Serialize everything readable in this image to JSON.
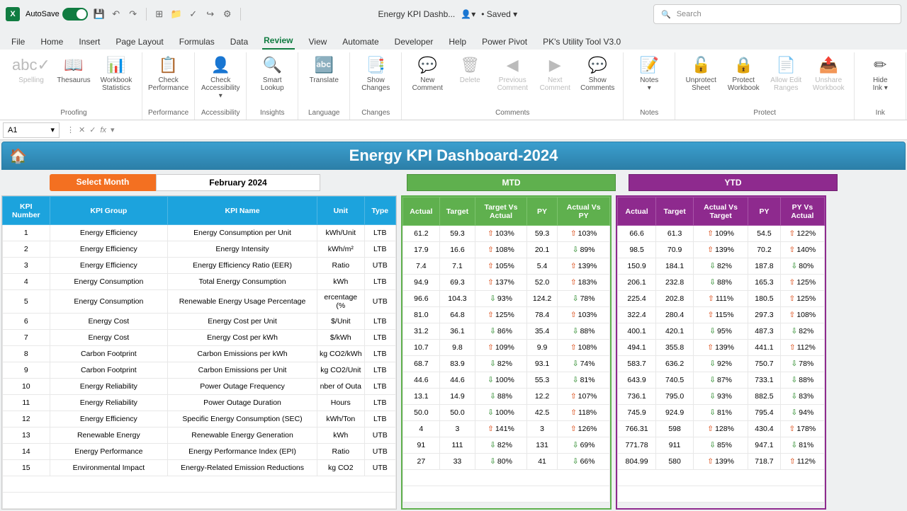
{
  "titlebar": {
    "autosave": "AutoSave",
    "docname": "Energy KPI Dashb...",
    "saved": "Saved",
    "search_ph": "Search"
  },
  "tabs": [
    "File",
    "Home",
    "Insert",
    "Page Layout",
    "Formulas",
    "Data",
    "Review",
    "View",
    "Automate",
    "Developer",
    "Help",
    "Power Pivot",
    "PK's Utility Tool V3.0"
  ],
  "active_tab": "Review",
  "ribbon": {
    "proofing": {
      "label": "Proofing",
      "items": [
        {
          "l": "Spelling",
          "i": "abc✓",
          "d": true
        },
        {
          "l": "Thesaurus",
          "i": "📖"
        },
        {
          "l": "Workbook\nStatistics",
          "i": "📊"
        }
      ]
    },
    "performance": {
      "label": "Performance",
      "items": [
        {
          "l": "Check\nPerformance",
          "i": "📋"
        }
      ]
    },
    "accessibility": {
      "label": "Accessibility",
      "items": [
        {
          "l": "Check\nAccessibility ▾",
          "i": "👤"
        }
      ]
    },
    "insights": {
      "label": "Insights",
      "items": [
        {
          "l": "Smart\nLookup",
          "i": "🔍"
        }
      ]
    },
    "language": {
      "label": "Language",
      "items": [
        {
          "l": "Translate",
          "i": "🔤"
        }
      ]
    },
    "changes": {
      "label": "Changes",
      "items": [
        {
          "l": "Show\nChanges",
          "i": "📑"
        }
      ]
    },
    "comments": {
      "label": "Comments",
      "items": [
        {
          "l": "New\nComment",
          "i": "💬"
        },
        {
          "l": "Delete",
          "i": "🗑",
          "d": true
        },
        {
          "l": "Previous\nComment",
          "i": "◀",
          "d": true
        },
        {
          "l": "Next\nComment",
          "i": "▶",
          "d": true
        },
        {
          "l": "Show\nComments",
          "i": "💬"
        }
      ]
    },
    "notes": {
      "label": "Notes",
      "items": [
        {
          "l": "Notes\n▾",
          "i": "📝"
        }
      ]
    },
    "protect": {
      "label": "Protect",
      "items": [
        {
          "l": "Unprotect\nSheet",
          "i": "🔓"
        },
        {
          "l": "Protect\nWorkbook",
          "i": "🔒"
        },
        {
          "l": "Allow Edit\nRanges",
          "i": "📄",
          "d": true
        },
        {
          "l": "Unshare\nWorkbook",
          "i": "📤",
          "d": true
        }
      ]
    },
    "ink": {
      "label": "Ink",
      "items": [
        {
          "l": "Hide\nInk ▾",
          "i": "✏"
        }
      ]
    }
  },
  "namebox": "A1",
  "dashboard": {
    "title": "Energy KPI Dashboard-2024",
    "select_month_lbl": "Select Month",
    "select_month_val": "February 2024",
    "mtd_lbl": "MTD",
    "ytd_lbl": "YTD",
    "kpi_cols": [
      "KPI\nNumber",
      "KPI Group",
      "KPI Name",
      "Unit",
      "Type"
    ],
    "mtd_cols": [
      "Actual",
      "Target",
      "Target Vs\nActual",
      "PY",
      "Actual Vs\nPY"
    ],
    "ytd_cols": [
      "Actual",
      "Target",
      "Actual Vs\nTarget",
      "PY",
      "PY Vs\nActual"
    ],
    "rows": [
      {
        "n": 1,
        "g": "Energy Efficiency",
        "k": "Energy Consumption per Unit",
        "u": "kWh/Unit",
        "t": "LTB",
        "m": [
          "61.2",
          "59.3",
          "↑ 103%",
          "59.3",
          "↑ 103%"
        ],
        "y": [
          "66.6",
          "61.3",
          "↑ 109%",
          "54.5",
          "↑ 122%"
        ]
      },
      {
        "n": 2,
        "g": "Energy Efficiency",
        "k": "Energy Intensity",
        "u": "kWh/m²",
        "t": "LTB",
        "m": [
          "17.9",
          "16.6",
          "↑ 108%",
          "20.1",
          "↓ 89%"
        ],
        "y": [
          "98.5",
          "70.9",
          "↑ 139%",
          "70.2",
          "↑ 140%"
        ]
      },
      {
        "n": 3,
        "g": "Energy Efficiency",
        "k": "Energy Efficiency Ratio (EER)",
        "u": "Ratio",
        "t": "UTB",
        "m": [
          "7.4",
          "7.1",
          "↑ 105%",
          "5.4",
          "↑ 139%"
        ],
        "y": [
          "150.9",
          "184.1",
          "↓ 82%",
          "187.8",
          "↓ 80%"
        ]
      },
      {
        "n": 4,
        "g": "Energy Consumption",
        "k": "Total Energy Consumption",
        "u": "kWh",
        "t": "LTB",
        "m": [
          "94.9",
          "69.3",
          "↑ 137%",
          "52.0",
          "↑ 183%"
        ],
        "y": [
          "206.1",
          "232.8",
          "↓ 88%",
          "165.3",
          "↑ 125%"
        ]
      },
      {
        "n": 5,
        "g": "Energy Consumption",
        "k": "Renewable Energy Usage Percentage",
        "u": "ercentage (%",
        "t": "UTB",
        "m": [
          "96.6",
          "104.3",
          "↓ 93%",
          "124.2",
          "↓ 78%"
        ],
        "y": [
          "225.4",
          "202.8",
          "↑ 111%",
          "180.5",
          "↑ 125%"
        ]
      },
      {
        "n": 6,
        "g": "Energy Cost",
        "k": "Energy Cost per Unit",
        "u": "$/Unit",
        "t": "LTB",
        "m": [
          "81.0",
          "64.8",
          "↑ 125%",
          "78.4",
          "↑ 103%"
        ],
        "y": [
          "322.4",
          "280.4",
          "↑ 115%",
          "297.3",
          "↑ 108%"
        ]
      },
      {
        "n": 7,
        "g": "Energy Cost",
        "k": "Energy Cost per kWh",
        "u": "$/kWh",
        "t": "LTB",
        "m": [
          "31.2",
          "36.1",
          "↓ 86%",
          "35.4",
          "↓ 88%"
        ],
        "y": [
          "400.1",
          "420.1",
          "↓ 95%",
          "487.3",
          "↓ 82%"
        ]
      },
      {
        "n": 8,
        "g": "Carbon Footprint",
        "k": "Carbon Emissions per kWh",
        "u": "kg CO2/kWh",
        "t": "LTB",
        "m": [
          "10.7",
          "9.8",
          "↑ 109%",
          "9.9",
          "↑ 108%"
        ],
        "y": [
          "494.1",
          "355.8",
          "↑ 139%",
          "441.1",
          "↑ 112%"
        ]
      },
      {
        "n": 9,
        "g": "Carbon Footprint",
        "k": "Carbon Emissions per Unit",
        "u": "kg CO2/Unit",
        "t": "LTB",
        "m": [
          "68.7",
          "83.9",
          "↓ 82%",
          "93.1",
          "↓ 74%"
        ],
        "y": [
          "583.7",
          "636.2",
          "↓ 92%",
          "750.7",
          "↓ 78%"
        ]
      },
      {
        "n": 10,
        "g": "Energy Reliability",
        "k": "Power Outage Frequency",
        "u": "nber of Outa",
        "t": "LTB",
        "m": [
          "44.6",
          "44.6",
          "↓ 100%",
          "55.3",
          "↓ 81%"
        ],
        "y": [
          "643.9",
          "740.5",
          "↓ 87%",
          "733.1",
          "↓ 88%"
        ]
      },
      {
        "n": 11,
        "g": "Energy Reliability",
        "k": "Power Outage Duration",
        "u": "Hours",
        "t": "LTB",
        "m": [
          "13.1",
          "14.9",
          "↓ 88%",
          "12.2",
          "↑ 107%"
        ],
        "y": [
          "736.1",
          "795.0",
          "↓ 93%",
          "882.5",
          "↓ 83%"
        ]
      },
      {
        "n": 12,
        "g": "Energy Efficiency",
        "k": "Specific Energy Consumption (SEC)",
        "u": "kWh/Ton",
        "t": "LTB",
        "m": [
          "50.0",
          "50.0",
          "↓ 100%",
          "42.5",
          "↑ 118%"
        ],
        "y": [
          "745.9",
          "924.9",
          "↓ 81%",
          "795.4",
          "↓ 94%"
        ]
      },
      {
        "n": 13,
        "g": "Renewable Energy",
        "k": "Renewable Energy Generation",
        "u": "kWh",
        "t": "UTB",
        "m": [
          "4",
          "3",
          "↑ 141%",
          "3",
          "↑ 126%"
        ],
        "y": [
          "766.31",
          "598",
          "↑ 128%",
          "430.4",
          "↑ 178%"
        ]
      },
      {
        "n": 14,
        "g": "Energy Performance",
        "k": "Energy Performance Index (EPI)",
        "u": "Ratio",
        "t": "UTB",
        "m": [
          "91",
          "111",
          "↓ 82%",
          "131",
          "↓ 69%"
        ],
        "y": [
          "771.78",
          "911",
          "↓ 85%",
          "947.1",
          "↓ 81%"
        ]
      },
      {
        "n": 15,
        "g": "Environmental Impact",
        "k": "Energy-Related Emission Reductions",
        "u": "kg CO2",
        "t": "UTB",
        "m": [
          "27",
          "33",
          "↓ 80%",
          "41",
          "↓ 66%"
        ],
        "y": [
          "804.99",
          "580",
          "↑ 139%",
          "718.7",
          "↑ 112%"
        ]
      }
    ]
  }
}
